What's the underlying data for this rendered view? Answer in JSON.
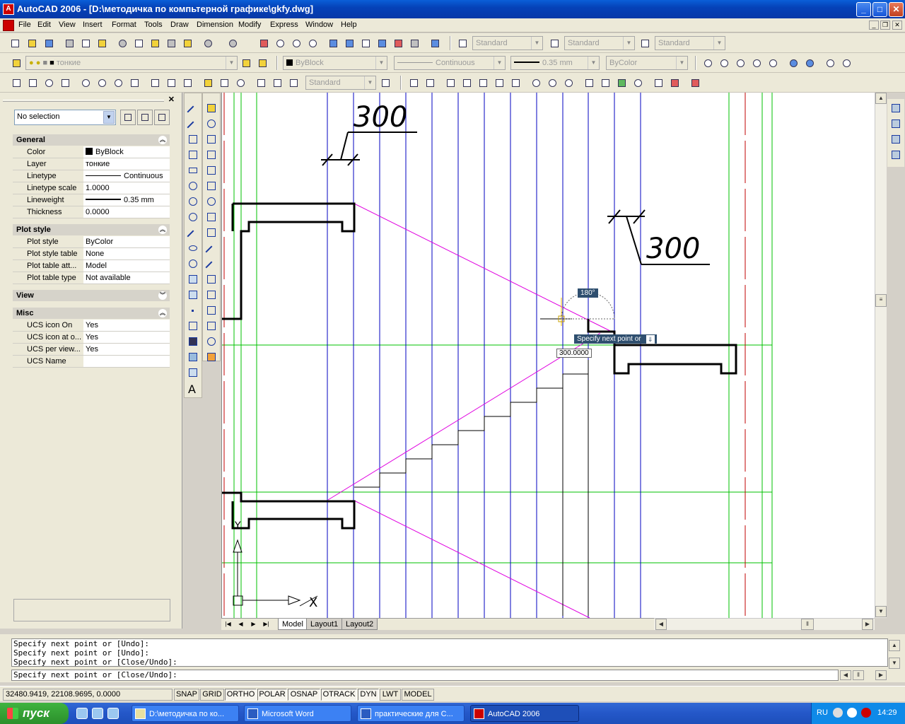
{
  "window": {
    "title": "AutoCAD 2006 - [D:\\методичка по компьтерной графике\\gkfy.dwg]",
    "minimize_label": "_",
    "maximize_label": "□",
    "close_label": "✕"
  },
  "menu": [
    "File",
    "Edit",
    "View",
    "Insert",
    "Format",
    "Tools",
    "Draw",
    "Dimension",
    "Modify",
    "Express",
    "Window",
    "Help"
  ],
  "toolbars": {
    "text_style": "Standard",
    "dim_style": "Standard",
    "table_style": "Standard",
    "layer": "тонкие",
    "color": "ByBlock",
    "linetype": "Continuous",
    "lineweight": "0.35 mm",
    "plot_style": "ByColor",
    "dim_style2": "Standard"
  },
  "properties": {
    "selection": "No selection",
    "close_label": "✕",
    "sections": {
      "general": "General",
      "plot_style": "Plot style",
      "view": "View",
      "misc": "Misc"
    },
    "general": [
      {
        "key": "Color",
        "value": "ByBlock"
      },
      {
        "key": "Layer",
        "value": "тонкие"
      },
      {
        "key": "Linetype",
        "value": "Continuous"
      },
      {
        "key": "Linetype scale",
        "value": "1.0000"
      },
      {
        "key": "Lineweight",
        "value": "0.35 mm"
      },
      {
        "key": "Thickness",
        "value": "0.0000"
      }
    ],
    "plot": [
      {
        "key": "Plot style",
        "value": "ByColor"
      },
      {
        "key": "Plot style table",
        "value": "None"
      },
      {
        "key": "Plot table att...",
        "value": "Model"
      },
      {
        "key": "Plot table type",
        "value": "Not available"
      }
    ],
    "misc": [
      {
        "key": "UCS icon On",
        "value": "Yes"
      },
      {
        "key": "UCS icon at o...",
        "value": "Yes"
      },
      {
        "key": "UCS per view...",
        "value": "Yes"
      },
      {
        "key": "UCS Name",
        "value": ""
      }
    ]
  },
  "drawing": {
    "dim_top": "300",
    "dim_right": "300",
    "angle_tip": "180°",
    "prompt_tip": "Specify next point or",
    "dyn_value": "300.0000",
    "ucs_y": "Y",
    "ucs_x": "X"
  },
  "layout_tabs": [
    "Model",
    "Layout1",
    "Layout2"
  ],
  "command": {
    "history": [
      "Specify next point or [Undo]:",
      "Specify next point or [Undo]:",
      "Specify next point or [Close/Undo]:"
    ],
    "current": "Specify next point or [Close/Undo]:"
  },
  "status": {
    "coords": "32480.9419, 22108.9695, 0.0000",
    "buttons": [
      "SNAP",
      "GRID",
      "ORTHO",
      "POLAR",
      "OSNAP",
      "OTRACK",
      "DYN",
      "LWT",
      "MODEL"
    ]
  },
  "taskbar": {
    "start": "пуск",
    "tasks": [
      "D:\\методичка по ко...",
      "Microsoft Word",
      "практические для С...",
      "AutoCAD 2006"
    ],
    "lang": "RU",
    "time": "14:29"
  },
  "colors": {
    "title_blue": "#0542b8",
    "grid_green": "#00c000",
    "grid_blue": "#0000c0",
    "magenta": "#e000e0",
    "red": "#c00000"
  }
}
